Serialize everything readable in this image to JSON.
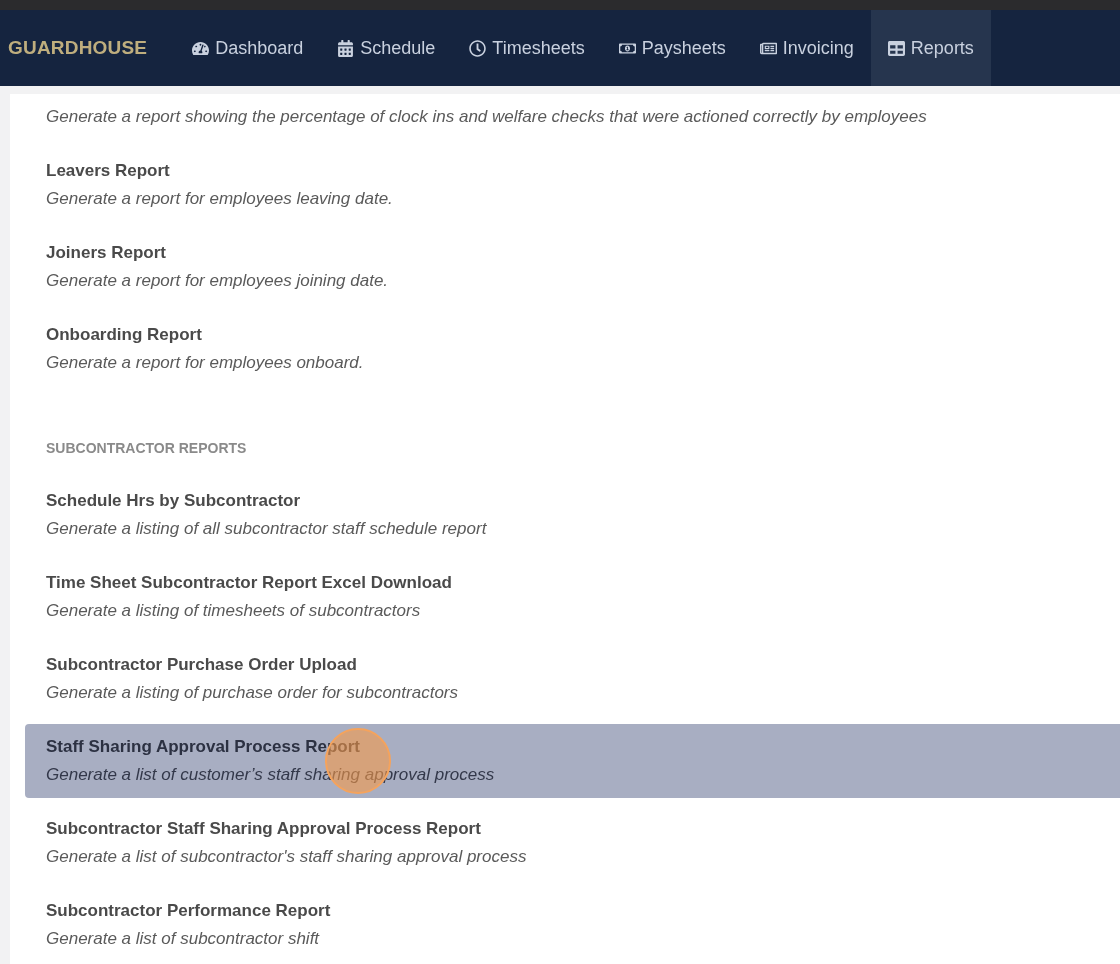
{
  "brand": "GUARDHOUSE",
  "nav": [
    {
      "label": "Dashboard",
      "selected": false
    },
    {
      "label": "Schedule",
      "selected": false
    },
    {
      "label": "Timesheets",
      "selected": false
    },
    {
      "label": "Paysheets",
      "selected": false
    },
    {
      "label": "Invoicing",
      "selected": false
    },
    {
      "label": "Reports",
      "selected": true
    }
  ],
  "sections": [
    {
      "items": [
        {
          "description": "Generate a report showing the percentage of clock ins and welfare checks that were actioned correctly by employees",
          "selected": false
        },
        {
          "title": "Leavers Report",
          "description": "Generate a report for employees leaving date.",
          "selected": false
        },
        {
          "title": "Joiners Report",
          "description": "Generate a report for employees joining date.",
          "selected": false
        },
        {
          "title": "Onboarding Report",
          "description": "Generate a report for employees onboard.",
          "selected": false
        }
      ]
    },
    {
      "heading": "SUBCONTRACTOR REPORTS",
      "items": [
        {
          "title": "Schedule Hrs by Subcontractor",
          "description": "Generate a listing of all subcontractor staff schedule report",
          "selected": false
        },
        {
          "title": "Time Sheet Subcontractor Report Excel Download",
          "description": "Generate a listing of timesheets of subcontractors",
          "selected": false
        },
        {
          "title": "Subcontractor Purchase Order Upload",
          "description": "Generate a listing of purchase order for subcontractors",
          "selected": false
        },
        {
          "title": "Staff Sharing Approval Process Report",
          "description": "Generate a list of customer’s staff sharing approval process",
          "selected": true
        },
        {
          "title": "Subcontractor Staff Sharing Approval Process Report",
          "description": "Generate a list of subcontractor's staff sharing approval process",
          "selected": false
        },
        {
          "title": "Subcontractor Performance Report",
          "description": "Generate a list of subcontractor shift",
          "selected": false
        }
      ]
    }
  ]
}
